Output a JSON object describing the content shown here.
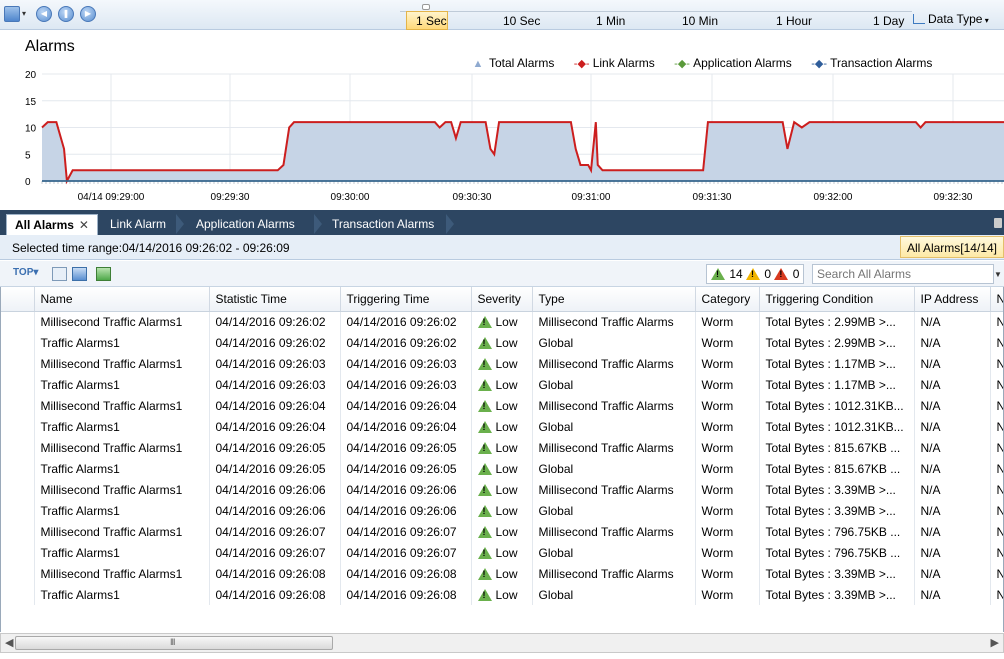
{
  "toolbar": {
    "time_scales": [
      "1 Sec",
      "10 Sec",
      "1 Min",
      "10 Min",
      "1 Hour",
      "1 Day"
    ],
    "selected_scale": "1 Sec",
    "data_type_label": "Data Type"
  },
  "chart": {
    "title": "Alarms",
    "legend": [
      "Total Alarms",
      "Link Alarms",
      "Application Alarms",
      "Transaction Alarms"
    ]
  },
  "chart_data": {
    "type": "area",
    "title": "Alarms",
    "y_ticks": [
      "20",
      "15",
      "10",
      "5",
      "0"
    ],
    "ylim": [
      0,
      20
    ],
    "grid": true,
    "legend_position": "top-right",
    "x_tick_labels": [
      "04/14 09:29:00",
      "09:29:30",
      "09:30:00",
      "09:30:30",
      "09:31:00",
      "09:31:30",
      "09:32:00",
      "09:32:30"
    ],
    "series": [
      {
        "name": "Total Alarms",
        "type": "area",
        "color": "#c6d4e6",
        "points": [
          [
            0,
            10
          ],
          [
            6,
            11
          ],
          [
            15,
            11
          ],
          [
            23,
            6
          ],
          [
            26,
            0
          ],
          [
            32,
            2
          ],
          [
            62,
            2
          ],
          [
            70,
            2
          ],
          [
            238,
            2
          ],
          [
            246,
            2
          ],
          [
            252,
            3
          ],
          [
            258,
            10
          ],
          [
            263,
            11
          ],
          [
            410,
            11
          ],
          [
            415,
            10
          ],
          [
            421,
            11
          ],
          [
            427,
            11
          ],
          [
            432,
            8
          ],
          [
            437,
            11
          ],
          [
            463,
            11
          ],
          [
            468,
            6
          ],
          [
            472,
            5
          ],
          [
            477,
            11
          ],
          [
            552,
            11
          ],
          [
            557,
            6
          ],
          [
            562,
            3
          ],
          [
            570,
            3
          ],
          [
            573,
            2
          ],
          [
            578,
            11
          ],
          [
            580,
            3
          ],
          [
            585,
            2
          ],
          [
            690,
            2
          ],
          [
            695,
            11
          ],
          [
            773,
            11
          ],
          [
            778,
            6
          ],
          [
            785,
            11
          ],
          [
            793,
            10
          ],
          [
            801,
            11
          ],
          [
            912,
            11
          ],
          [
            917,
            10
          ],
          [
            922,
            11
          ],
          [
            1004,
            11
          ]
        ]
      },
      {
        "name": "Link Alarms",
        "type": "line",
        "color": "#cc1e1e",
        "points": [
          [
            0,
            10
          ],
          [
            6,
            11
          ],
          [
            15,
            11
          ],
          [
            23,
            6
          ],
          [
            26,
            0
          ],
          [
            32,
            2
          ],
          [
            62,
            2
          ],
          [
            70,
            2
          ],
          [
            238,
            2
          ],
          [
            246,
            2
          ],
          [
            252,
            3
          ],
          [
            258,
            10
          ],
          [
            263,
            11
          ],
          [
            410,
            11
          ],
          [
            415,
            10
          ],
          [
            421,
            11
          ],
          [
            427,
            11
          ],
          [
            432,
            8
          ],
          [
            437,
            11
          ],
          [
            463,
            11
          ],
          [
            468,
            6
          ],
          [
            472,
            5
          ],
          [
            477,
            11
          ],
          [
            552,
            11
          ],
          [
            557,
            6
          ],
          [
            562,
            3
          ],
          [
            570,
            3
          ],
          [
            573,
            2
          ],
          [
            578,
            11
          ],
          [
            580,
            3
          ],
          [
            585,
            2
          ],
          [
            690,
            2
          ],
          [
            695,
            11
          ],
          [
            773,
            11
          ],
          [
            778,
            6
          ],
          [
            785,
            11
          ],
          [
            793,
            10
          ],
          [
            801,
            11
          ],
          [
            912,
            11
          ],
          [
            917,
            10
          ],
          [
            922,
            11
          ],
          [
            1004,
            11
          ]
        ]
      },
      {
        "name": "Application Alarms",
        "type": "line",
        "color": "#5a9a3a",
        "points": [
          [
            0,
            0
          ],
          [
            1004,
            0
          ]
        ]
      },
      {
        "name": "Transaction Alarms",
        "type": "line",
        "color": "#2f5d9a",
        "points": [
          [
            0,
            0
          ],
          [
            1004,
            0
          ]
        ]
      }
    ]
  },
  "tabs": [
    {
      "label": "All Alarms",
      "active": true
    },
    {
      "label": "Link Alarm",
      "active": false
    },
    {
      "label": "Application Alarms",
      "active": false
    },
    {
      "label": "Transaction Alarms",
      "active": false
    }
  ],
  "range": {
    "text": "Selected time range:04/14/2016  09:26:02 - 09:26:09",
    "count_label": "All Alarms[14/14]"
  },
  "filter": {
    "low_count": "14",
    "mid_count": "0",
    "high_count": "0",
    "search_placeholder": "Search All Alarms"
  },
  "table": {
    "columns": [
      "Name",
      "Statistic Time",
      "Triggering Time",
      "Severity",
      "Type",
      "Category",
      "Triggering Condition",
      "IP Address",
      "N"
    ],
    "rows": [
      [
        "Millisecond Traffic Alarms1",
        "04/14/2016 09:26:02",
        "04/14/2016 09:26:02",
        "Low",
        "Millisecond Traffic Alarms",
        "Worm",
        "Total Bytes : 2.99MB >...",
        "N/A",
        "N"
      ],
      [
        "Traffic Alarms1",
        "04/14/2016 09:26:02",
        "04/14/2016 09:26:02",
        "Low",
        "Global",
        "Worm",
        "Total Bytes : 2.99MB >...",
        "N/A",
        "N"
      ],
      [
        "Millisecond Traffic Alarms1",
        "04/14/2016 09:26:03",
        "04/14/2016 09:26:03",
        "Low",
        "Millisecond Traffic Alarms",
        "Worm",
        "Total Bytes : 1.17MB >...",
        "N/A",
        "N"
      ],
      [
        "Traffic Alarms1",
        "04/14/2016 09:26:03",
        "04/14/2016 09:26:03",
        "Low",
        "Global",
        "Worm",
        "Total Bytes : 1.17MB >...",
        "N/A",
        "N"
      ],
      [
        "Millisecond Traffic Alarms1",
        "04/14/2016 09:26:04",
        "04/14/2016 09:26:04",
        "Low",
        "Millisecond Traffic Alarms",
        "Worm",
        "Total Bytes : 1012.31KB...",
        "N/A",
        "N"
      ],
      [
        "Traffic Alarms1",
        "04/14/2016 09:26:04",
        "04/14/2016 09:26:04",
        "Low",
        "Global",
        "Worm",
        "Total Bytes : 1012.31KB...",
        "N/A",
        "N"
      ],
      [
        "Millisecond Traffic Alarms1",
        "04/14/2016 09:26:05",
        "04/14/2016 09:26:05",
        "Low",
        "Millisecond Traffic Alarms",
        "Worm",
        "Total Bytes : 815.67KB ...",
        "N/A",
        "N"
      ],
      [
        "Traffic Alarms1",
        "04/14/2016 09:26:05",
        "04/14/2016 09:26:05",
        "Low",
        "Global",
        "Worm",
        "Total Bytes : 815.67KB ...",
        "N/A",
        "N"
      ],
      [
        "Millisecond Traffic Alarms1",
        "04/14/2016 09:26:06",
        "04/14/2016 09:26:06",
        "Low",
        "Millisecond Traffic Alarms",
        "Worm",
        "Total Bytes : 3.39MB >...",
        "N/A",
        "N"
      ],
      [
        "Traffic Alarms1",
        "04/14/2016 09:26:06",
        "04/14/2016 09:26:06",
        "Low",
        "Global",
        "Worm",
        "Total Bytes : 3.39MB >...",
        "N/A",
        "N"
      ],
      [
        "Millisecond Traffic Alarms1",
        "04/14/2016 09:26:07",
        "04/14/2016 09:26:07",
        "Low",
        "Millisecond Traffic Alarms",
        "Worm",
        "Total Bytes : 796.75KB ...",
        "N/A",
        "N"
      ],
      [
        "Traffic Alarms1",
        "04/14/2016 09:26:07",
        "04/14/2016 09:26:07",
        "Low",
        "Global",
        "Worm",
        "Total Bytes : 796.75KB ...",
        "N/A",
        "N"
      ],
      [
        "Millisecond Traffic Alarms1",
        "04/14/2016 09:26:08",
        "04/14/2016 09:26:08",
        "Low",
        "Millisecond Traffic Alarms",
        "Worm",
        "Total Bytes : 3.39MB >...",
        "N/A",
        "N"
      ],
      [
        "Traffic Alarms1",
        "04/14/2016 09:26:08",
        "04/14/2016 09:26:08",
        "Low",
        "Global",
        "Worm",
        "Total Bytes : 3.39MB >...",
        "N/A",
        "N"
      ]
    ]
  },
  "scrollbar": {
    "grip": "III"
  },
  "colors": {
    "low": "#6ab04c",
    "medium": "#f0b400",
    "high": "#d83a1f",
    "tab_bar": "#2d4662"
  }
}
